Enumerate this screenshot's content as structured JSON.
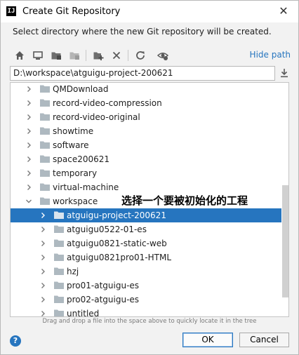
{
  "window": {
    "app_icon": "IJ",
    "title": "Create Git Repository",
    "close_glyph": "✕"
  },
  "description": "Select directory where the new Git repository will be created.",
  "toolbar": {
    "icons": [
      "home-icon",
      "desktop-icon",
      "project-folder-icon",
      "module-folder-icon",
      "new-folder-icon",
      "delete-icon",
      "refresh-icon",
      "show-hidden-icon"
    ],
    "hide_path_label": "Hide path"
  },
  "path": {
    "value": "D:\\workspace\\atguigu-project-200621"
  },
  "tree": {
    "items": [
      {
        "label": "QMDownload",
        "depth": 0,
        "expanded": false,
        "selected": false
      },
      {
        "label": "record-video-compression",
        "depth": 0,
        "expanded": false,
        "selected": false
      },
      {
        "label": "record-video-original",
        "depth": 0,
        "expanded": false,
        "selected": false
      },
      {
        "label": "showtime",
        "depth": 0,
        "expanded": false,
        "selected": false
      },
      {
        "label": "software",
        "depth": 0,
        "expanded": false,
        "selected": false
      },
      {
        "label": "space200621",
        "depth": 0,
        "expanded": false,
        "selected": false
      },
      {
        "label": "temporary",
        "depth": 0,
        "expanded": false,
        "selected": false
      },
      {
        "label": "virtual-machine",
        "depth": 0,
        "expanded": false,
        "selected": false
      },
      {
        "label": "workspace",
        "depth": 0,
        "expanded": true,
        "selected": false
      },
      {
        "label": "atguigu-project-200621",
        "depth": 1,
        "expanded": false,
        "selected": true
      },
      {
        "label": "atguigu0522-01-es",
        "depth": 1,
        "expanded": false,
        "selected": false
      },
      {
        "label": "atguigu0821-static-web",
        "depth": 1,
        "expanded": false,
        "selected": false
      },
      {
        "label": "atguigu0821pro01-HTML",
        "depth": 1,
        "expanded": false,
        "selected": false
      },
      {
        "label": "hzj",
        "depth": 1,
        "expanded": false,
        "selected": false
      },
      {
        "label": "pro01-atguigu-es",
        "depth": 1,
        "expanded": false,
        "selected": false
      },
      {
        "label": "pro02-atguigu-es",
        "depth": 1,
        "expanded": false,
        "selected": false
      },
      {
        "label": "untitled",
        "depth": 1,
        "expanded": false,
        "selected": false
      }
    ]
  },
  "annotation": "选择一个要被初始化的工程",
  "hint": "Drag and drop a file into the space above to quickly locate it in the tree",
  "buttons": {
    "help": "?",
    "ok": "OK",
    "cancel": "Cancel"
  },
  "colors": {
    "accent": "#2675bf",
    "folder": "#aeb9c0",
    "selected_text": "#ffffff"
  }
}
